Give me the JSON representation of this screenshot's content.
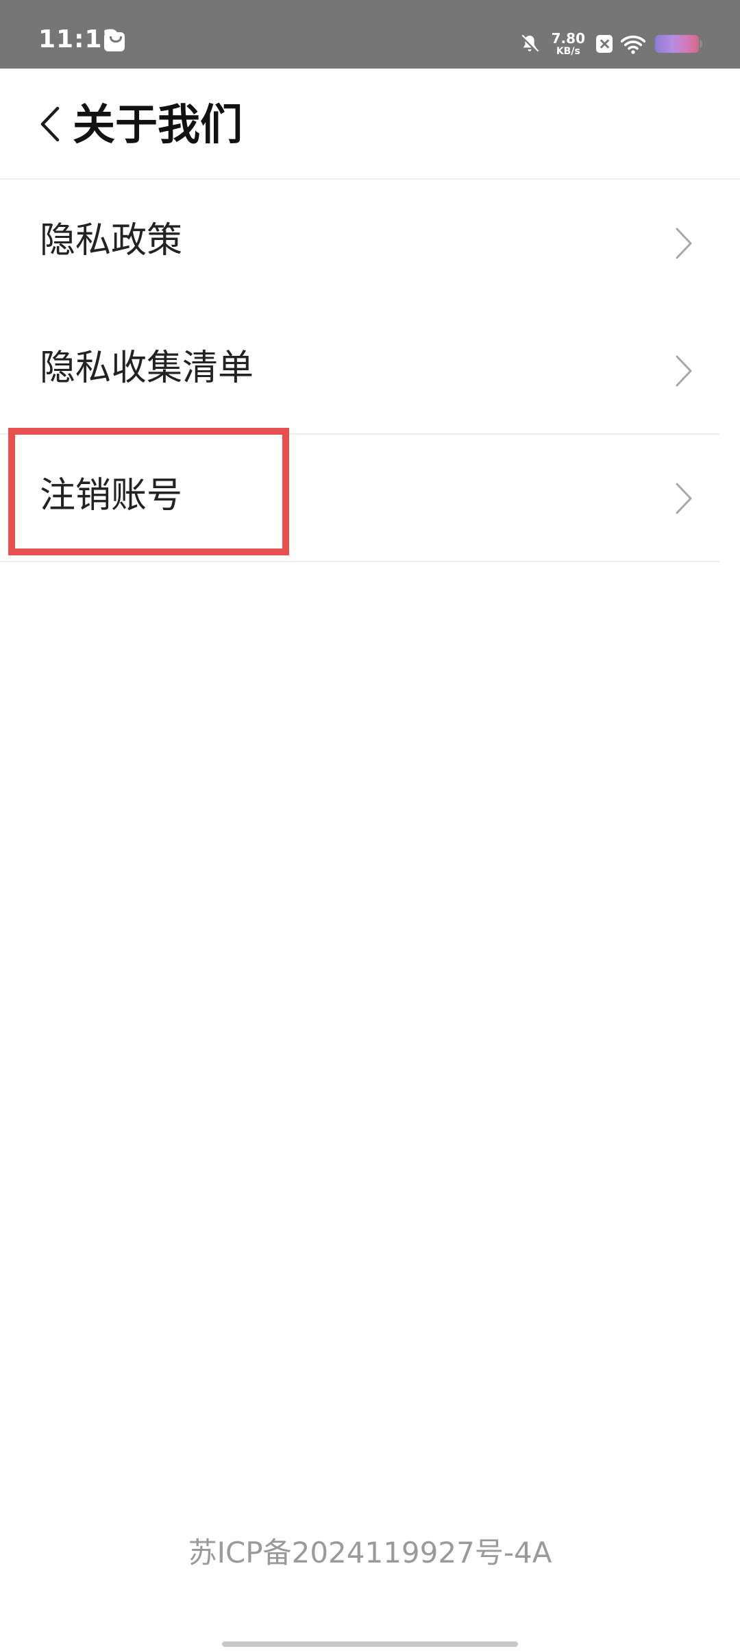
{
  "status_bar": {
    "time": "11:12",
    "net_speed_value": "7.80",
    "net_speed_unit": "KB/s"
  },
  "nav": {
    "title": "关于我们"
  },
  "items": [
    {
      "label": "隐私政策"
    },
    {
      "label": "隐私收集清单"
    },
    {
      "label": "注销账号"
    }
  ],
  "footer": {
    "icp": "苏ICP备2024119927号-4A"
  },
  "colors": {
    "status_bar_bg": "#767676",
    "highlight": "#e85050",
    "footer_text": "#9a9a9a"
  },
  "icons": {
    "back": "chevron-left-icon",
    "item_arrow": "chevron-right-icon",
    "mute": "bell-off-icon",
    "wifi": "wifi-icon",
    "battery": "battery-icon"
  }
}
